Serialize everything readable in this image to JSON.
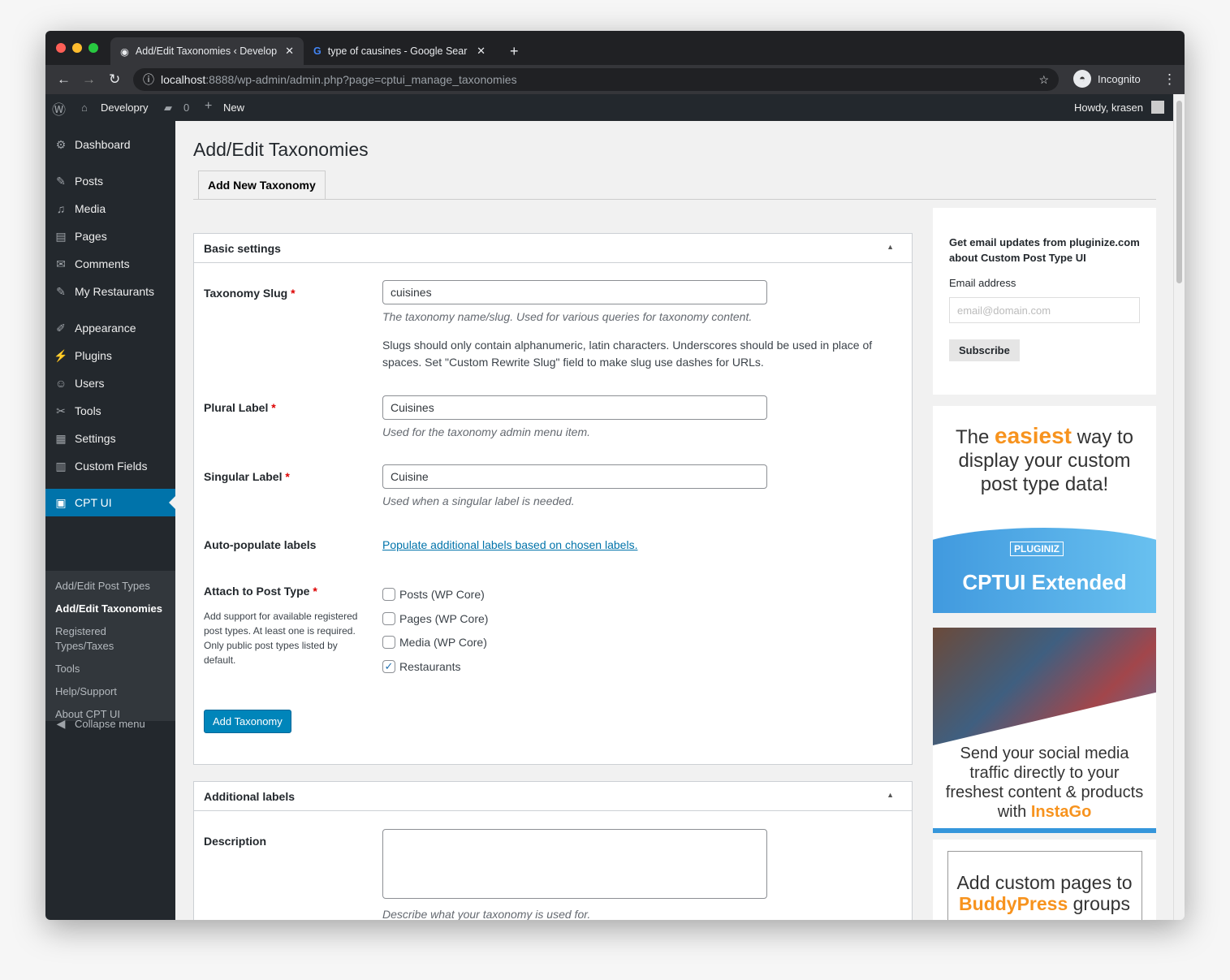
{
  "browser": {
    "tabs": [
      {
        "title": "Add/Edit Taxonomies ‹ Develop"
      },
      {
        "title": "type of causines - Google Sear"
      }
    ],
    "url_host": "localhost",
    "url_rest": ":8888/wp-admin/admin.php?page=cptui_manage_taxonomies",
    "profile": "Incognito"
  },
  "adminbar": {
    "site": "Developry",
    "comments": "0",
    "new": "New",
    "howdy": "Howdy, krasen"
  },
  "sidebar": {
    "items": [
      {
        "label": "Dashboard",
        "icon": "⚙"
      },
      {
        "label": "Posts",
        "icon": "✎"
      },
      {
        "label": "Media",
        "icon": "♫"
      },
      {
        "label": "Pages",
        "icon": "▤"
      },
      {
        "label": "Comments",
        "icon": "✉"
      },
      {
        "label": "My Restaurants",
        "icon": "✎"
      },
      {
        "label": "Appearance",
        "icon": "✐"
      },
      {
        "label": "Plugins",
        "icon": "⚡"
      },
      {
        "label": "Users",
        "icon": "☺"
      },
      {
        "label": "Tools",
        "icon": "✂"
      },
      {
        "label": "Settings",
        "icon": "▦"
      },
      {
        "label": "Custom Fields",
        "icon": "▥"
      },
      {
        "label": "CPT UI",
        "icon": "▣"
      }
    ],
    "submenu": [
      "Add/Edit Post Types",
      "Add/Edit Taxonomies",
      "Registered Types/Taxes",
      "Tools",
      "Help/Support",
      "About CPT UI"
    ],
    "collapse": "Collapse menu"
  },
  "page": {
    "title": "Add/Edit Taxonomies",
    "tab": "Add New Taxonomy"
  },
  "basic": {
    "heading": "Basic settings",
    "slug_label": "Taxonomy Slug",
    "slug_value": "cuisines",
    "slug_desc": "The taxonomy name/slug. Used for various queries for taxonomy content.",
    "slug_note": "Slugs should only contain alphanumeric, latin characters. Underscores should be used in place of spaces. Set \"Custom Rewrite Slug\" field to make slug use dashes for URLs.",
    "plural_label": "Plural Label",
    "plural_value": "Cuisines",
    "plural_desc": "Used for the taxonomy admin menu item.",
    "singular_label": "Singular Label",
    "singular_value": "Cuisine",
    "singular_desc": "Used when a singular label is needed.",
    "auto_label": "Auto-populate labels",
    "auto_link": "Populate additional labels based on chosen labels.",
    "attach_label": "Attach to Post Type",
    "attach_desc": "Add support for available registered post types. At least one is required. Only public post types listed by default.",
    "post_types": [
      {
        "label": "Posts (WP Core)",
        "checked": false
      },
      {
        "label": "Pages (WP Core)",
        "checked": false
      },
      {
        "label": "Media (WP Core)",
        "checked": false
      },
      {
        "label": "Restaurants",
        "checked": true
      }
    ],
    "submit": "Add Taxonomy",
    "required": "*"
  },
  "additional": {
    "heading": "Additional labels",
    "desc_label": "Description",
    "desc_help": "Describe what your taxonomy is used for."
  },
  "widget": {
    "intro": "Get email updates from pluginize.com about Custom Post Type UI",
    "email_label": "Email address",
    "email_placeholder": "email@domain.com",
    "subscribe": "Subscribe"
  },
  "ads": {
    "ad1_pre": "The ",
    "ad1_hl": "easiest",
    "ad1_post": " way to display your custom post type data!",
    "ad1_brand": "PLUGINIZ",
    "ad1_product": "CPTUI Extended",
    "ad2_text": "Send your social media traffic directly to your freshest content & products with ",
    "ad2_hl": "InstaGo",
    "ad3_text": "Add custom pages to ",
    "ad3_hl": "BuddyPress",
    "ad3_post": " groups"
  },
  "colors": {
    "accent": "#0073aa",
    "orange": "#f7931e",
    "button": "#0085ba"
  }
}
